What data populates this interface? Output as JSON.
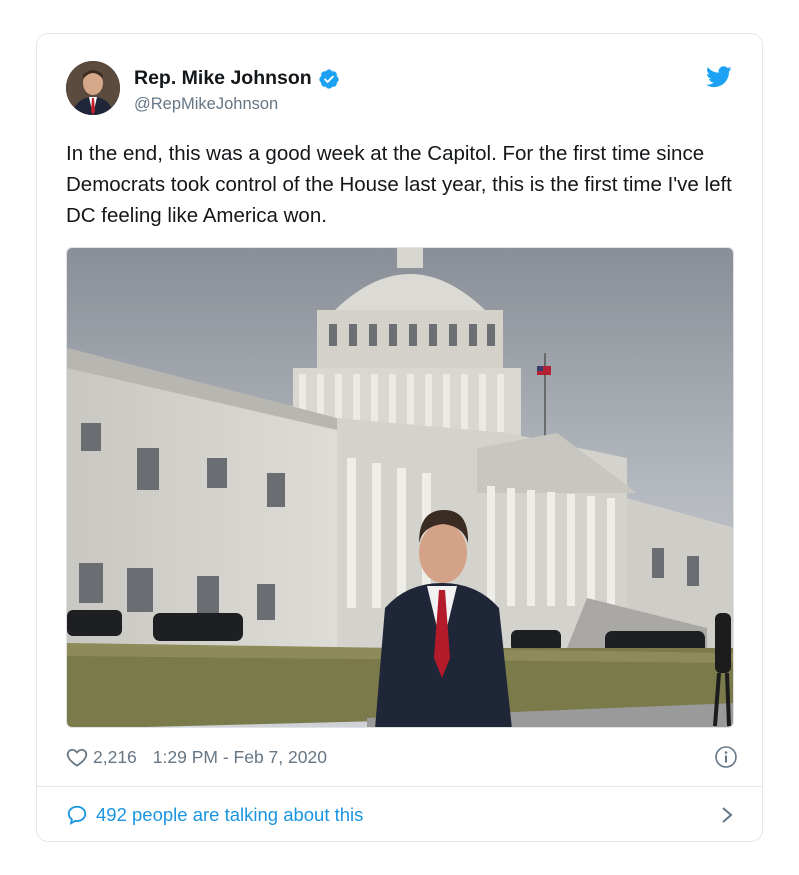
{
  "tweet": {
    "display_name": "Rep. Mike Johnson",
    "handle": "@RepMikeJohnson",
    "verified": true,
    "text": "In the end, this was a good week at the Capitol. For the first time since Democrats took control of the House last year, this is the first time I've left DC feeling like America won.",
    "likes": "2,216",
    "timestamp": "1:29 PM - Feb 7, 2020",
    "conversation_label": "492 people are talking about this"
  },
  "icons": {
    "brand": "twitter-bird-icon",
    "verified": "verified-badge-icon",
    "like": "heart-icon",
    "info": "info-icon",
    "reply": "speech-bubble-icon",
    "more": "chevron-right-icon"
  },
  "colors": {
    "accent": "#1da1f2",
    "link": "#1b95e0",
    "muted": "#657786",
    "text": "#14171a",
    "border": "#e1e8ed"
  }
}
